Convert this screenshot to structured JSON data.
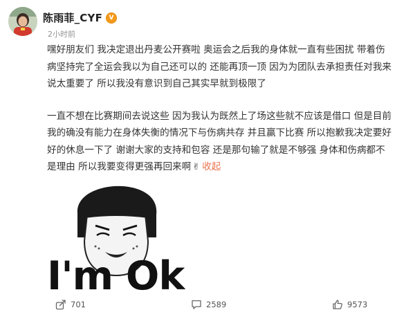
{
  "header": {
    "username": "陈雨菲_CYF",
    "badge_text": "V",
    "timestamp": "2小时前"
  },
  "post": {
    "paragraphs": [
      "嘿好朋友们 我决定退出丹麦公开赛啦 奥运会之后我的身体就一直有些困扰 带着伤病坚持完了全运会我以为自己还可以的 还能再顶一顶 因为为团队去承担责任对我来说太重要了 所以我没有意识到自己其实早就到极限了",
      "一直不想在比赛期间去说这些 因为我认为既然上了场这些就不应该是借口 但是目前我的确没有能力在身体失衡的情况下与伤病共存 并且赢下比赛 所以抱歉我决定要好好的休息一下了 谢谢大家的支持和包容 还是那句输了就是不够强 身体和伤病都不是理由 所以我要变得更强再回来啊"
    ],
    "emoji": "✌",
    "collapse_label": "收起",
    "meme_caption": "I'm Ok"
  },
  "actions": {
    "share_count": "701",
    "comment_count": "2589",
    "like_count": "9573"
  },
  "colors": {
    "accent": "#eb7350",
    "badge": "#f59a1b",
    "muted": "#939393"
  },
  "icons": [
    "avatar",
    "verified-badge-icon",
    "victory-hand-icon",
    "share-icon",
    "comment-icon",
    "like-icon"
  ]
}
